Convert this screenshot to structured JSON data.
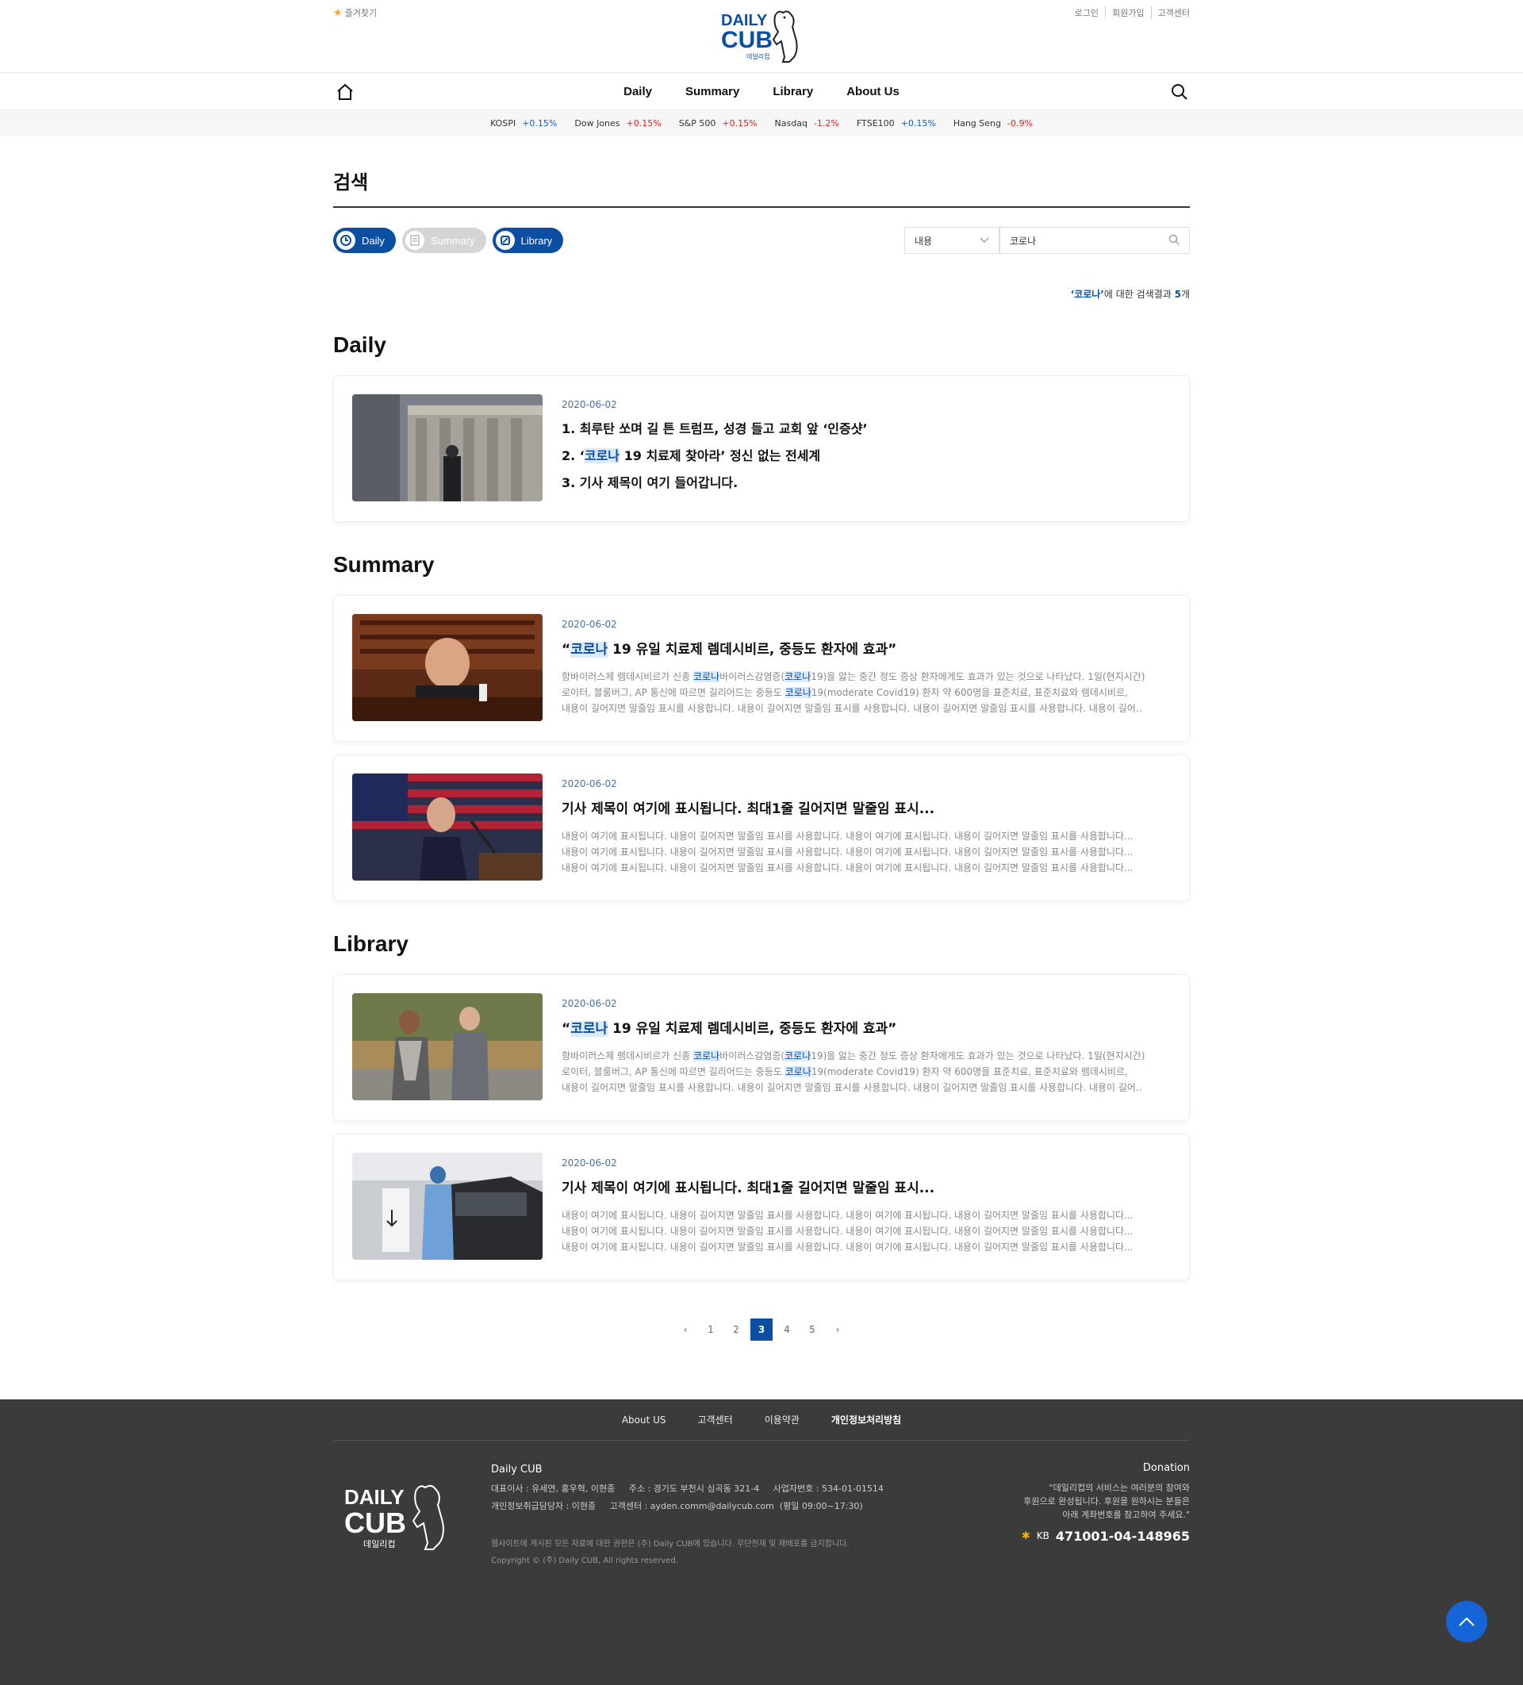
{
  "header": {
    "favorites": "즐겨찾기",
    "logo_text_1": "DAILY",
    "logo_text_2": "CUB",
    "logo_sub": "데일리컵",
    "util": [
      "로그인",
      "회원가입",
      "고객센터"
    ]
  },
  "nav": {
    "items": [
      "Daily",
      "Summary",
      "Library",
      "About Us"
    ]
  },
  "ticker": [
    {
      "name": "KOSPI",
      "change": "+0.15%",
      "dir": "up"
    },
    {
      "name": "Dow Jones",
      "change": "+0.15%",
      "dir": "down"
    },
    {
      "name": "S&P 500",
      "change": "+0.15%",
      "dir": "down"
    },
    {
      "name": "Nasdaq",
      "change": "-1.2%",
      "dir": "down"
    },
    {
      "name": "FTSE100",
      "change": "+0.15%",
      "dir": "up"
    },
    {
      "name": "Hang Seng",
      "change": "-0.9%",
      "dir": "down"
    }
  ],
  "page": {
    "title": "검색",
    "filters": [
      "Daily",
      "Summary",
      "Library"
    ],
    "select_value": "내용",
    "search_value": "코로나",
    "result_prefix": "‘코로나’",
    "result_mid": "에 대한 검색결과 ",
    "result_count": "5",
    "result_suffix": "개"
  },
  "daily": {
    "heading": "Daily",
    "card": {
      "date": "2020-06-02",
      "line1": "1. 최루탄 쏘며 길 튼 트럼프, 성경 들고 교회 앞 ‘인증샷’",
      "line2_a": "2. ‘",
      "line2_hl": "코로나",
      "line2_b": " 19 치료제 찾아라’ 정신 없는 전세계",
      "line3": "3. 기사 제목이 여기 들어갑니다."
    }
  },
  "summary": {
    "heading": "Summary",
    "cards": [
      {
        "date": "2020-06-02",
        "title_a": "“",
        "title_hl": "코로나",
        "title_b": " 19 유일 치료제 렘데시비르, 중등도 환자에 효과”",
        "d1a": "항바이러스제 렘데시비르가 신종 ",
        "d1h1": "코로나",
        "d1b": "바이러스감염증(",
        "d1h2": "코로나",
        "d1c": "19)을 앓는 중간 정도 증상 환자에게도 효과가 있는 것으로 나타났다. 1일(현지시간)",
        "d2a": "로이터, 블룸버그, AP 통신에 따르면 길리어드는 중등도 ",
        "d2h": "코로나",
        "d2b": "19(moderate Covid19) 환자 약 600명을 표준치료, 표준치료와 렘데시비르,",
        "d3": "내용이 길어지면 말줄임 표시를 사용합니다. 내용이 길어지면 말줄임 표시를 사용합니다. 내용이 길어지면 말줄임 표시를 사용합니다. 내용이 길어.."
      },
      {
        "date": "2020-06-02",
        "title": "기사 제목이 여기에 표시됩니다. 최대1줄 길어지면 말줄임 표시...",
        "d1": "내용이 여기에 표시됩니다. 내용이 길어지면 말줄임 표시를 사용합니다. 내용이 여기에 표시됩니다. 내용이 길어지면 말줄임 표시를 사용합니다...",
        "d2": "내용이 여기에 표시됩니다. 내용이 길어지면 말줄임 표시를 사용합니다. 내용이 여기에 표시됩니다. 내용이 길어지면 말줄임 표시를 사용합니다...",
        "d3": "내용이 여기에 표시됩니다. 내용이 길어지면 말줄임 표시를 사용합니다. 내용이 여기에 표시됩니다. 내용이 길어지면 말줄임 표시를 사용합니다..."
      }
    ]
  },
  "library": {
    "heading": "Library",
    "cards": [
      {
        "date": "2020-06-02",
        "title_a": "“",
        "title_hl": "코로나",
        "title_b": " 19 유일 치료제 렘데시비르, 중등도 환자에 효과”",
        "d1a": "항바이러스제 렘데시비르가 신종 ",
        "d1h1": "코로나",
        "d1b": "바이러스감염증(",
        "d1h2": "코로나",
        "d1c": "19)을 앓는 중간 정도 증상 환자에게도 효과가 있는 것으로 나타났다. 1일(현지시간)",
        "d2a": "로이터, 블룸버그, AP 통신에 따르면 길리어드는 중등도 ",
        "d2h": "코로나",
        "d2b": "19(moderate Covid19) 환자 약 600명을 표준치료, 표준치료와 렘데시비르,",
        "d3": "내용이 길어지면 말줄임 표시를 사용합니다. 내용이 길어지면 말줄임 표시를 사용합니다. 내용이 길어지면 말줄임 표시를 사용합니다. 내용이 길어.."
      },
      {
        "date": "2020-06-02",
        "title": "기사 제목이 여기에 표시됩니다. 최대1줄 길어지면 말줄임 표시...",
        "d1": "내용이 여기에 표시됩니다. 내용이 길어지면 말줄임 표시를 사용합니다. 내용이 여기에 표시됩니다. 내용이 길어지면 말줄임 표시를 사용합니다...",
        "d2": "내용이 여기에 표시됩니다. 내용이 길어지면 말줄임 표시를 사용합니다. 내용이 여기에 표시됩니다. 내용이 길어지면 말줄임 표시를 사용합니다...",
        "d3": "내용이 여기에 표시됩니다. 내용이 길어지면 말줄임 표시를 사용합니다. 내용이 여기에 표시됩니다. 내용이 길어지면 말줄임 표시를 사용합니다..."
      }
    ]
  },
  "pagination": {
    "pages": [
      "1",
      "2",
      "3",
      "4",
      "5"
    ],
    "current": "3",
    "prev": "‹",
    "next": "›"
  },
  "footer": {
    "links": [
      "About US",
      "고객센터",
      "이용약관",
      "개인정보처리방침"
    ],
    "company": "Daily CUB",
    "info1": "대표이사 : 유세연, 홍우혁, 이현종     주소 : 경기도 부천시 심곡동 321-4     사업자번호 : 534-01-01514",
    "info2": "개인정보취급담당자 : 이현종     고객센터 : ayden.comm@dailycub.com  (평일 09:00~17:30)",
    "copy1": "웹사이트에 게시된 모든 자료에 대한 권한은 (주) Daily CUB에 있습니다. 무단전재 및 재배포를 금지합니다.",
    "copy2": "Copyright © (주) Daily CUB, All rights reserved.",
    "donation_title": "Donation",
    "donation1": "\"데일리컵의 서비스는 여러분의 참여와",
    "donation2": "후원으로 완성됩니다. 후원을 원하시는 분들은",
    "donation3": "아래 계좌번호를 참고하여 주세요.\"",
    "bank": "KB",
    "account": "471001-04-148965",
    "logo_text_1": "DAILY",
    "logo_text_2": "CUB",
    "logo_sub": "데일리컵"
  },
  "colors": {
    "brand": "#0b4ea2",
    "up": "#1560bd",
    "down": "#e02020",
    "footer_bg": "#3b3b3b",
    "top_button": "#1565d8"
  }
}
